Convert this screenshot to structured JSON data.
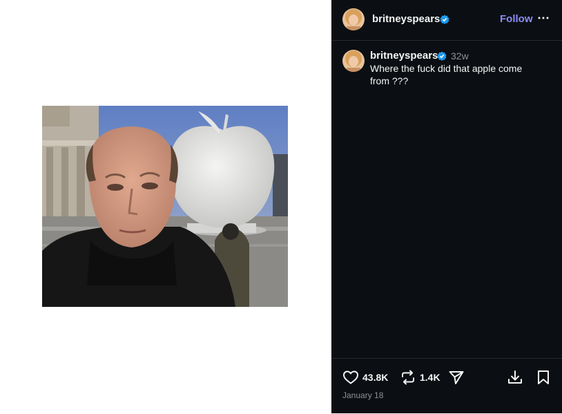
{
  "header": {
    "username": "britneyspears",
    "follow_label": "Follow",
    "more_icon": "more-horizontal-icon"
  },
  "post": {
    "username": "britneyspears",
    "age": "32w",
    "caption": "Where the fuck did that apple come from ???"
  },
  "media": {
    "icon": "photo"
  },
  "actions": {
    "like_count": "43.8K",
    "repost_count": "1.4K",
    "like_icon": "heart-icon",
    "repost_icon": "repost-icon",
    "share_icon": "send-icon",
    "download_icon": "download-icon",
    "save_icon": "bookmark-icon"
  },
  "date": "January 18",
  "colors": {
    "panel_bg": "#0b0f13",
    "accent_follow": "#8b8cf8",
    "verified": "#1d9bf0",
    "muted": "#8e9196"
  }
}
